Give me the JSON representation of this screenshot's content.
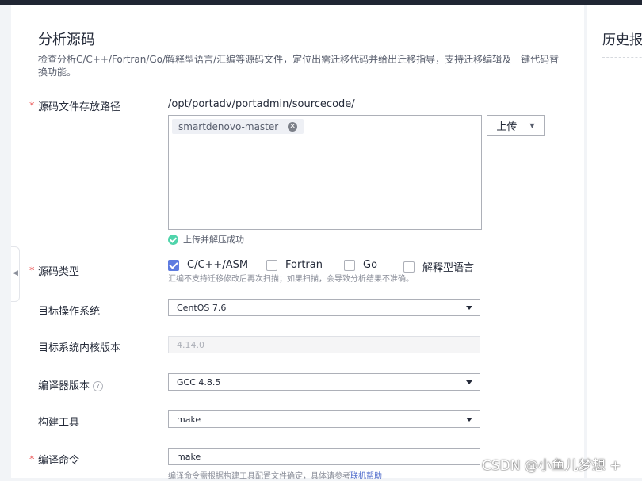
{
  "page": {
    "title": "分析源码",
    "description": "检查分析C/C++/Fortran/Go/解释型语言/汇编等源码文件，定位出需迁移代码并给出迁移指导，支持迁移编辑及一键代码替换功能。"
  },
  "side_panel": {
    "title": "历史报"
  },
  "form": {
    "required_mark": "*",
    "source_path": {
      "label": "源码文件存放路径",
      "path": "/opt/portadv/portadmin/sourcecode/",
      "file_chip": "smartdenovo-master",
      "upload_button": "上传",
      "upload_status": "上传并解压成功"
    },
    "source_type": {
      "label": "源码类型",
      "options": [
        {
          "label": "C/C++/ASM",
          "checked": true
        },
        {
          "label": "Fortran",
          "checked": false
        },
        {
          "label": "Go",
          "checked": false
        },
        {
          "label": "解释型语言",
          "checked": false
        }
      ],
      "hint": "汇编不支持迁移修改后再次扫描；如果扫描，会导致分析结果不准确。"
    },
    "target_os": {
      "label": "目标操作系统",
      "value": "CentOS 7.6"
    },
    "kernel": {
      "label": "目标系统内核版本",
      "value": "4.14.0"
    },
    "compiler": {
      "label": "编译器版本",
      "value": "GCC 4.8.5"
    },
    "build_tool": {
      "label": "构建工具",
      "value": "make"
    },
    "build_cmd": {
      "label": "编译命令",
      "value": "make",
      "hint": "编译命令需根据构建工具配置文件确定，具体请参考",
      "hint_link": "联机帮助"
    }
  },
  "watermark": "CSDN @小鱼儿梦想 +",
  "colors": {
    "accent": "#5e7ce0",
    "required": "#ea4d4d",
    "success": "#50d4ab"
  }
}
